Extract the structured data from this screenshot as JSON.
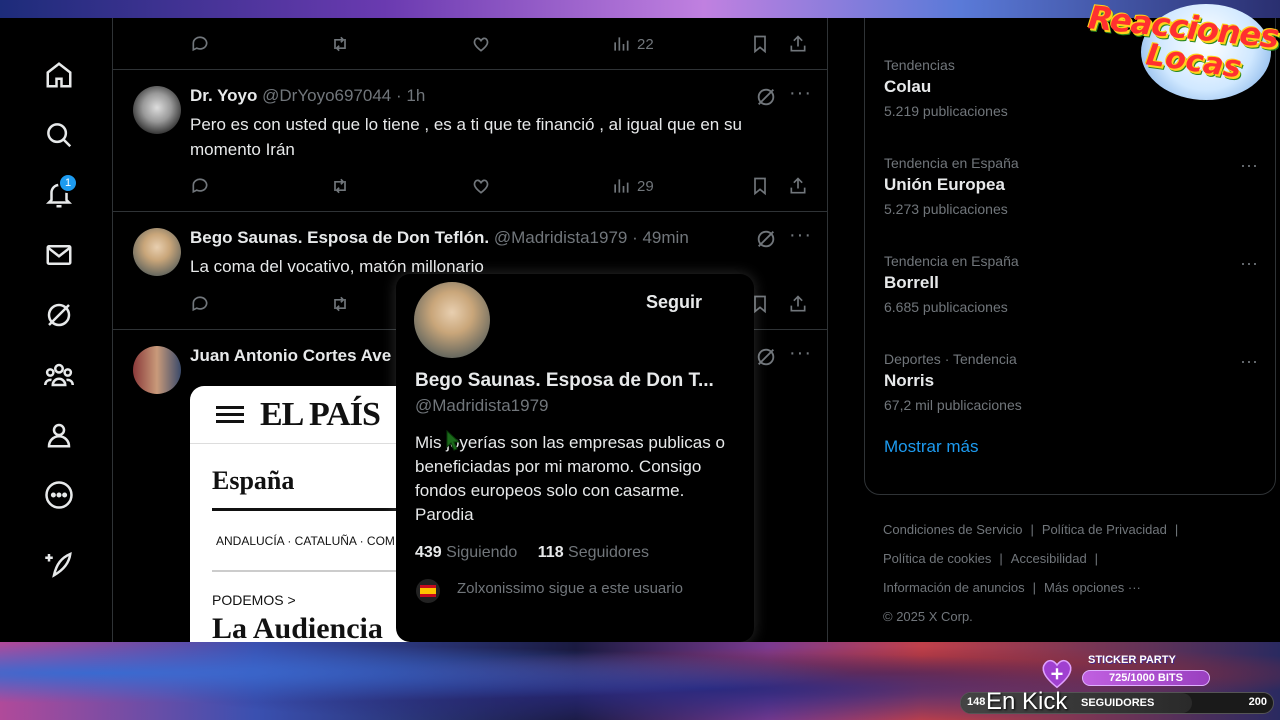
{
  "nav": {
    "notifications_badge": "1",
    "icons": [
      "home-icon",
      "search-icon",
      "bell-icon",
      "mail-icon",
      "grok-icon",
      "communities-icon",
      "profile-icon",
      "more-icon",
      "post-icon"
    ]
  },
  "timeline": {
    "top_row": {
      "views": "22"
    },
    "tweets": [
      {
        "name": "Dr. Yoyo",
        "handle": "@DrYoyo697044",
        "time": "· 1h",
        "text": "Pero es con usted que lo tiene , es a ti que te financió , al igual que en su momento Irán",
        "views": "29"
      },
      {
        "name": "Bego Saunas. Esposa de Don Teflón.",
        "handle": "@Madridista1979",
        "time": "· 49min",
        "text": "La coma del vocativo, matón millonario"
      },
      {
        "name": "Juan Antonio Cortes Ave"
      }
    ],
    "news_card": {
      "masthead": "EL PAÍS",
      "section": "España",
      "nav": "ANDALUCÍA · CATALUÑA · COM",
      "kicker": "PODEMOS >",
      "headline": "La Audiencia"
    }
  },
  "hovercard": {
    "follow_label": "Seguir",
    "name": "Bego Saunas. Esposa de Don T...",
    "handle": "@Madridista1979",
    "bio": "Mis joyerías son las empresas publicas o beneficiadas por mi maromo. Consigo fondos europeos solo con casarme. Parodia",
    "following_count": "439",
    "following_label": "Siguiendo",
    "followers_count": "118",
    "followers_label": "Seguidores",
    "followed_by": "Zolxonissimo sigue a este usuario"
  },
  "trends": [
    {
      "meta": "Tendencias",
      "topic": "Colau",
      "count": "5.219 publicaciones"
    },
    {
      "meta": "Tendencia en España",
      "topic": "Unión Europea",
      "count": "5.273 publicaciones"
    },
    {
      "meta": "Tendencia en España",
      "topic": "Borrell",
      "count": "6.685 publicaciones"
    },
    {
      "meta": "Deportes · Tendencia",
      "topic": "Norris",
      "count": "67,2 mil publicaciones"
    }
  ],
  "show_more": "Mostrar más",
  "footer": {
    "terms": "Condiciones de Servicio",
    "privacy": "Política de Privacidad",
    "cookies": "Política de cookies",
    "accessibility": "Accesibilidad",
    "ads": "Información de anuncios",
    "more": "Más opciones ···",
    "copyright": "© 2025 X Corp."
  },
  "stream": {
    "logo_line1": "Reacciones",
    "logo_line2": "Locas",
    "sticker_title": "STICKER PARTY",
    "sticker_progress": "725/1000 BITS",
    "followers_current": "148",
    "followers_label": "SEGUIDORES",
    "followers_goal": "200",
    "followers_fraction": 0.74,
    "platform_text": "En Kick"
  },
  "colors": {
    "accent": "#1d9bf0",
    "background": "#000000",
    "muted": "#71767b",
    "text": "#e7e9ea"
  }
}
